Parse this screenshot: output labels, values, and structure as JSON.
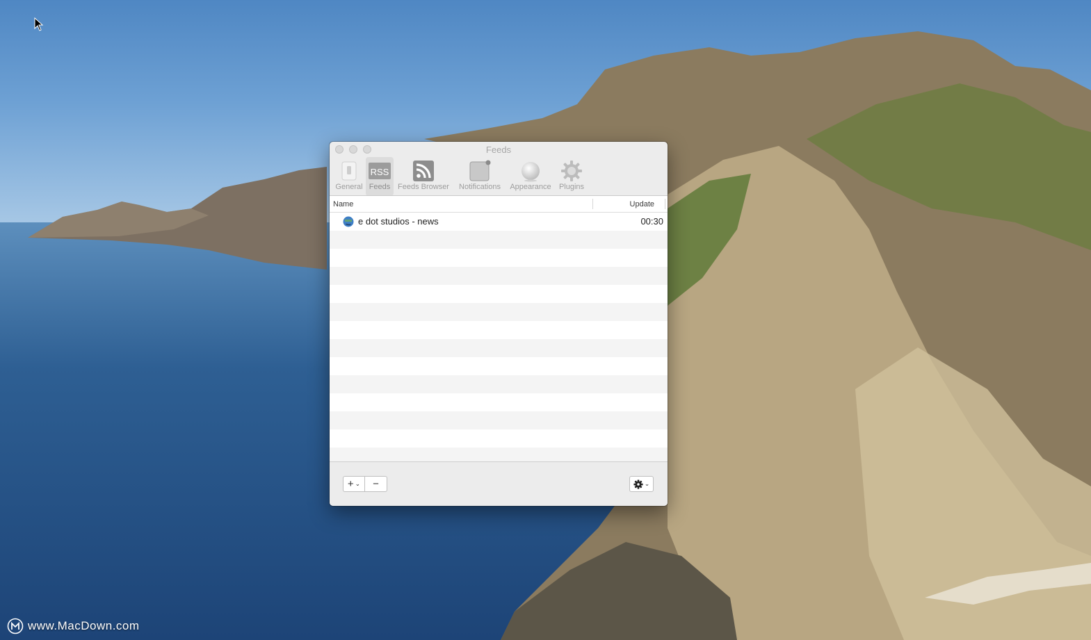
{
  "window": {
    "title": "Feeds"
  },
  "toolbar": {
    "items": [
      {
        "label": "General",
        "icon": "switch-icon",
        "selected": false
      },
      {
        "label": "Feeds",
        "icon": "rss-icon",
        "selected": true
      },
      {
        "label": "Feeds Browser",
        "icon": "rss-feed-icon",
        "selected": false
      },
      {
        "label": "Notifications",
        "icon": "notification-badge-icon",
        "selected": false
      },
      {
        "label": "Appearance",
        "icon": "sphere-icon",
        "selected": false
      },
      {
        "label": "Plugins",
        "icon": "gear-icon",
        "selected": false
      }
    ],
    "rss_text": "RSS"
  },
  "table": {
    "columns": [
      "Name",
      "Update"
    ],
    "rows": [
      {
        "name": "e dot studios - news",
        "update": "00:30",
        "icon": "globe-icon"
      }
    ]
  },
  "bottom": {
    "add_label": "+",
    "remove_label": "−",
    "chevron": "⌄"
  },
  "watermark": {
    "text": "www.MacDown.com"
  },
  "colors": {
    "window_bg": "#ececec",
    "row_alt": "#f4f4f4",
    "toolbar_label": "#9d9d9d"
  }
}
